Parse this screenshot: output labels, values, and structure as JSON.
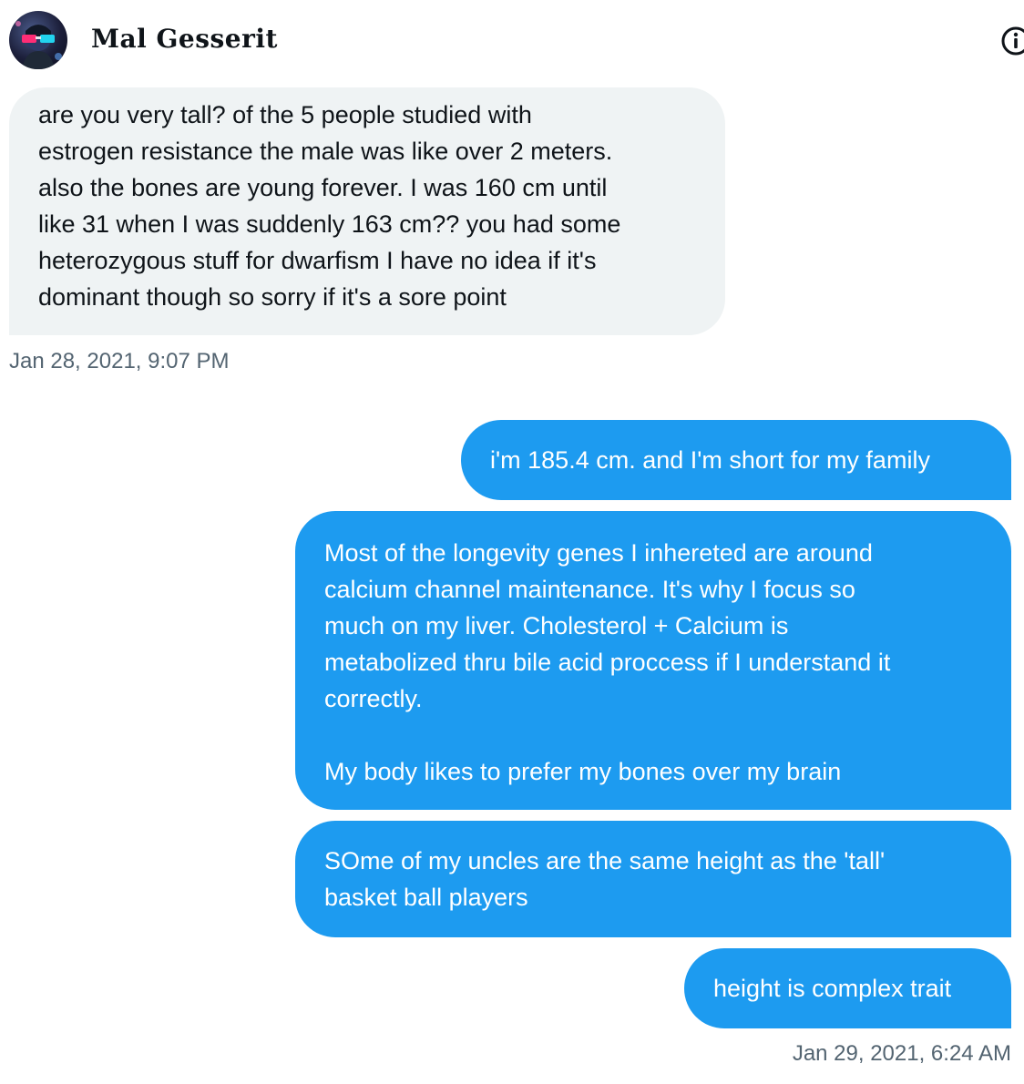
{
  "conversation": {
    "contact_name": "Mal Gesserit",
    "avatar_icon": "avatar-3d-glasses-icon",
    "info_icon": "info-icon"
  },
  "messages": [
    {
      "direction": "in",
      "text": "are you very tall? of the 5 people studied with\nestrogen resistance the male was like over 2 meters.\nalso the bones are young forever. I was 160 cm until\nlike 31 when I was suddenly 163 cm?? you had some\nheterozygous stuff for dwarfism I have no idea if it's\ndominant though so sorry if it's a sore point",
      "timestamp": "Jan 28, 2021, 9:07 PM"
    },
    {
      "direction": "out",
      "text": "i'm 185.4 cm. and I'm short for my family"
    },
    {
      "direction": "out",
      "text": "Most of the longevity genes I inhereted are around\ncalcium channel maintenance. It's why I focus so\nmuch on my liver. Cholesterol + Calcium is\nmetabolized thru bile acid proccess if I understand it\ncorrectly.\n\nMy body likes to prefer my bones over my brain"
    },
    {
      "direction": "out",
      "text": "SOme of my uncles are the same height as the 'tall'\nbasket ball players"
    },
    {
      "direction": "out",
      "text": "height is complex trait",
      "timestamp": "Jan 29, 2021, 6:24 AM"
    }
  ],
  "colors": {
    "incoming_bubble": "#eff3f4",
    "outgoing_bubble": "#1d9bf0",
    "timestamp_text": "#536471"
  }
}
